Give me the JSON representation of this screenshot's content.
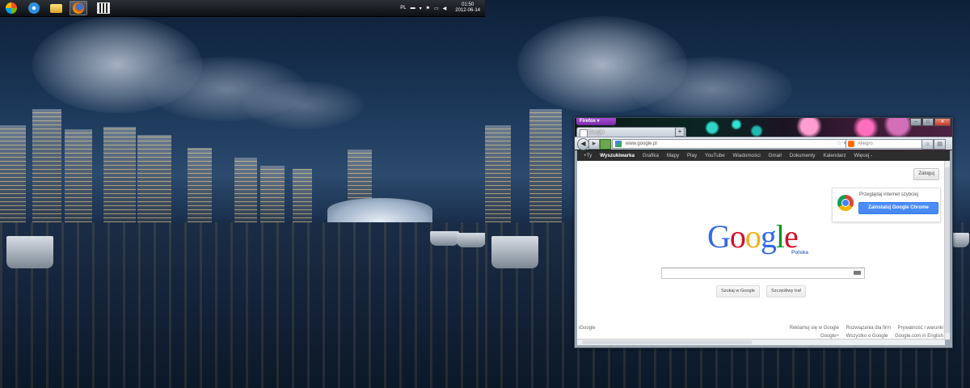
{
  "taskbar": {
    "language": "PL",
    "clock_time": "01:50",
    "clock_date": "2012-06-14",
    "apps": [
      {
        "name": "windows-start",
        "icon": "windows-orb-icon"
      },
      {
        "name": "internet-explorer",
        "icon": "ie-icon"
      },
      {
        "name": "windows-explorer",
        "icon": "folder-icon"
      },
      {
        "name": "firefox",
        "icon": "firefox-icon",
        "active": true
      },
      {
        "name": "media-app",
        "icon": "clapperboard-icon"
      }
    ]
  },
  "firefox": {
    "menu_button": "Firefox",
    "tab_title": "Google",
    "new_tab": "+",
    "url": "www.google.pl",
    "search_placeholder": "Allegro",
    "win_min": "–",
    "win_max": "□",
    "win_close": "✕"
  },
  "gbar": {
    "items": [
      "+Ty",
      "Wyszukiwarka",
      "Grafika",
      "Mapy",
      "Play",
      "YouTube",
      "Wiadomości",
      "Gmail",
      "Dokumenty",
      "Kalendarz",
      "Więcej -"
    ],
    "selected_index": 1
  },
  "google": {
    "login": "Zaloguj",
    "promo_text": "Przeglądaj internet szybciej",
    "promo_button": "Zainstaluj Google Chrome",
    "logo_letters": [
      "G",
      "o",
      "o",
      "g",
      "l",
      "e"
    ],
    "logo_sub": "Polska",
    "search_button": "Szukaj w Google",
    "lucky_button": "Szczęśliwy traf",
    "footer_left": "iGoogle",
    "footer_row1": [
      "Reklamuj się w Google",
      "Rozwiązania dla firm",
      "Prywatność i warunki"
    ],
    "footer_row2": [
      "Google+",
      "Wszystko o Google",
      "Google.com in English"
    ]
  },
  "colors": {
    "google_blue": "#3369e8",
    "google_red": "#d50f25",
    "google_yellow": "#eeb211",
    "google_green": "#009925",
    "firefox_purple": "#7a2aa8",
    "chrome_button": "#4787ed"
  }
}
